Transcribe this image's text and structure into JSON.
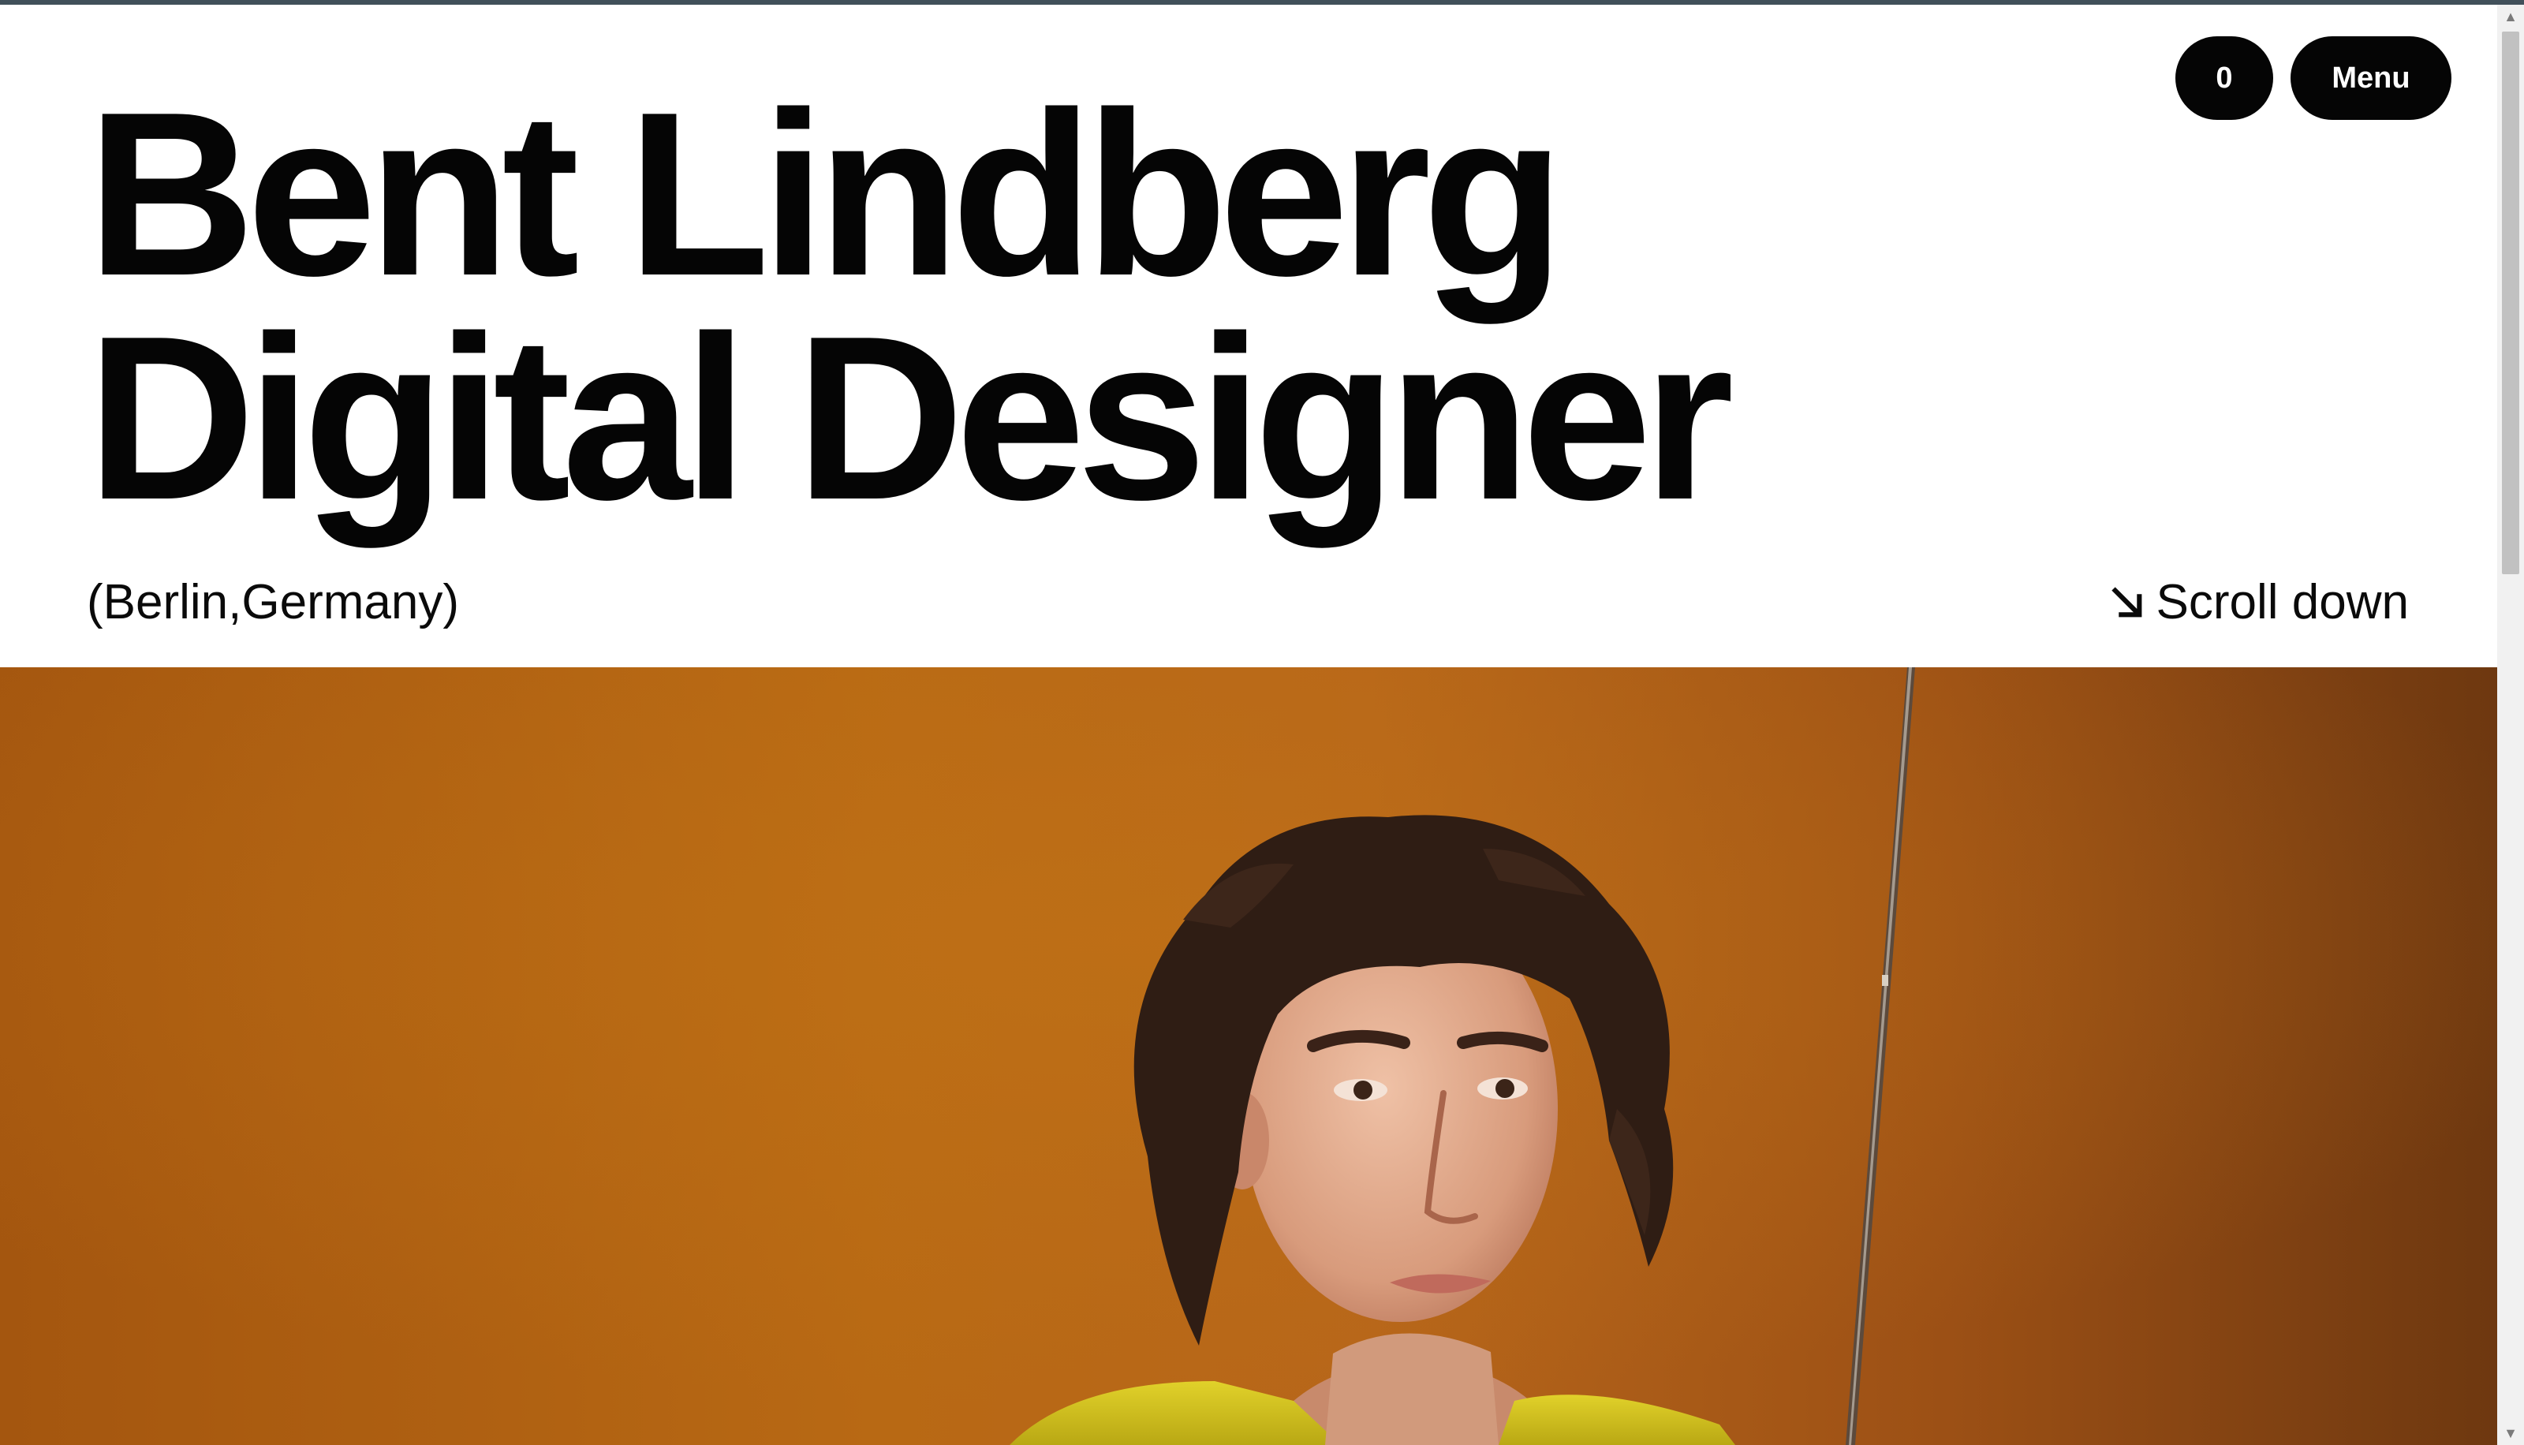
{
  "header": {
    "title_line_1": "Bent Lindberg",
    "title_line_2": "Digital Designer",
    "location": "(Berlin,Germany)",
    "scroll_label": "Scroll down",
    "scroll_icon": "arrow-down-right-icon"
  },
  "nav": {
    "counter_label": "0",
    "menu_label": "Menu"
  },
  "hero_image": {
    "subject": "portrait-photo",
    "background_color": "#b86914"
  },
  "colors": {
    "text": "#050505",
    "pill_bg": "#050505",
    "pill_text": "#ffffff",
    "page_bg": "#ffffff"
  }
}
